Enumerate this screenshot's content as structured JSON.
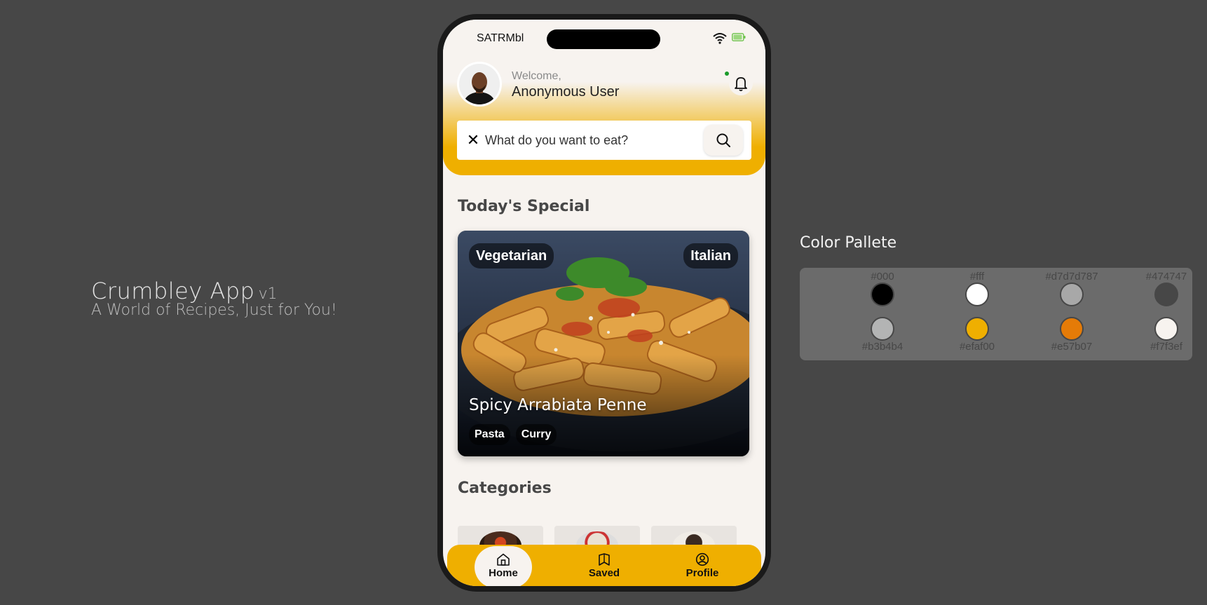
{
  "brand": {
    "name": "Crumbley App",
    "version": "v1",
    "tagline": "A World of Recipes, Just for You!"
  },
  "status_bar": {
    "carrier": "SATRMbl",
    "wifi_icon": "wifi-icon",
    "battery_icon": "battery-icon"
  },
  "header": {
    "welcome": "Welcome,",
    "username": "Anonymous User",
    "bell_icon": "bell-icon"
  },
  "search": {
    "placeholder": "What do you want to eat?",
    "clear_icon": "close-icon",
    "search_icon": "search-icon"
  },
  "todays_special": {
    "title": "Today's Special",
    "badge_left": "Vegetarian",
    "badge_right": "Italian",
    "dish_name": "Spicy Arrabiata Penne",
    "tags": [
      "Pasta",
      "Curry"
    ]
  },
  "categories": {
    "title": "Categories"
  },
  "nav": {
    "items": [
      {
        "label": "Home",
        "icon": "home-icon",
        "active": true
      },
      {
        "label": "Saved",
        "icon": "bookmark-icon",
        "active": false
      },
      {
        "label": "Profile",
        "icon": "profile-icon",
        "active": false
      }
    ]
  },
  "palette": {
    "title": "Color Pallete",
    "colors": [
      {
        "hex": "#000",
        "color": "#000000"
      },
      {
        "hex": "#fff",
        "color": "#ffffff"
      },
      {
        "hex": "#d7d7d787",
        "color": "#a8a8a8"
      },
      {
        "hex": "#474747",
        "color": "#474747"
      },
      {
        "hex": "#b3b4b4",
        "color": "#b3b4b4"
      },
      {
        "hex": "#efaf00",
        "color": "#efaf00"
      },
      {
        "hex": "#e57b07",
        "color": "#e57b07"
      },
      {
        "hex": "#f7f3ef",
        "color": "#f7f3ef"
      }
    ]
  }
}
